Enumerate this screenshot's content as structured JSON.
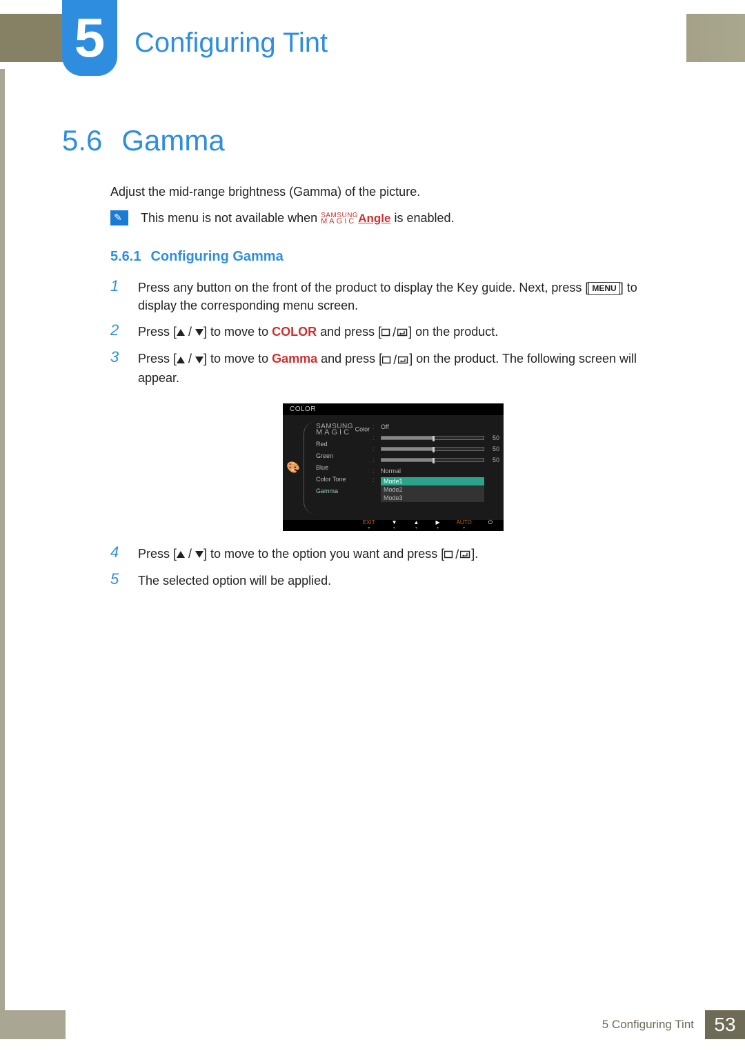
{
  "chapter": {
    "number": "5",
    "title": "Configuring Tint"
  },
  "section": {
    "number": "5.6",
    "title": "Gamma"
  },
  "intro": "Adjust the mid-range brightness (Gamma) of the picture.",
  "note": {
    "prefix": "This menu is not available when ",
    "magic_top": "SAMSUNG",
    "magic_bottom": "MAGIC",
    "angle": "Angle",
    "suffix": " is enabled."
  },
  "subsection": {
    "number": "5.6.1",
    "title": "Configuring Gamma"
  },
  "steps": {
    "s1": {
      "num": "1",
      "before": "Press any button on the front of the product to display the Key guide. Next, press [",
      "menu": "MENU",
      "after": "] to display the corresponding menu screen."
    },
    "s2": {
      "num": "2",
      "a": "Press [",
      "b": "] to move to ",
      "kw": "COLOR",
      "c": " and press [",
      "d": "] on the product."
    },
    "s3": {
      "num": "3",
      "a": "Press [",
      "b": "] to move to ",
      "kw": "Gamma",
      "c": " and press [",
      "d": "] on the product. The following screen will appear."
    },
    "s4": {
      "num": "4",
      "a": "Press [",
      "b": "] to move to the option you want and press [",
      "c": "]."
    },
    "s5": {
      "num": "5",
      "text": "The selected option will be applied."
    }
  },
  "osd": {
    "header": "COLOR",
    "labels": {
      "magic_top": "SAMSUNG",
      "magic_bottom": "MAGIC",
      "magic_color": "Color",
      "red": "Red",
      "green": "Green",
      "blue": "Blue",
      "color_tone": "Color Tone",
      "gamma": "Gamma"
    },
    "values": {
      "magic_color": "Off",
      "red": "50",
      "green": "50",
      "blue": "50",
      "color_tone": "Normal",
      "gamma_options": [
        "Mode1",
        "Mode2",
        "Mode3"
      ]
    },
    "footer": {
      "exit": "EXIT",
      "auto": "AUTO"
    }
  },
  "footer": {
    "chapter_ref": "5 Configuring Tint",
    "page": "53"
  }
}
